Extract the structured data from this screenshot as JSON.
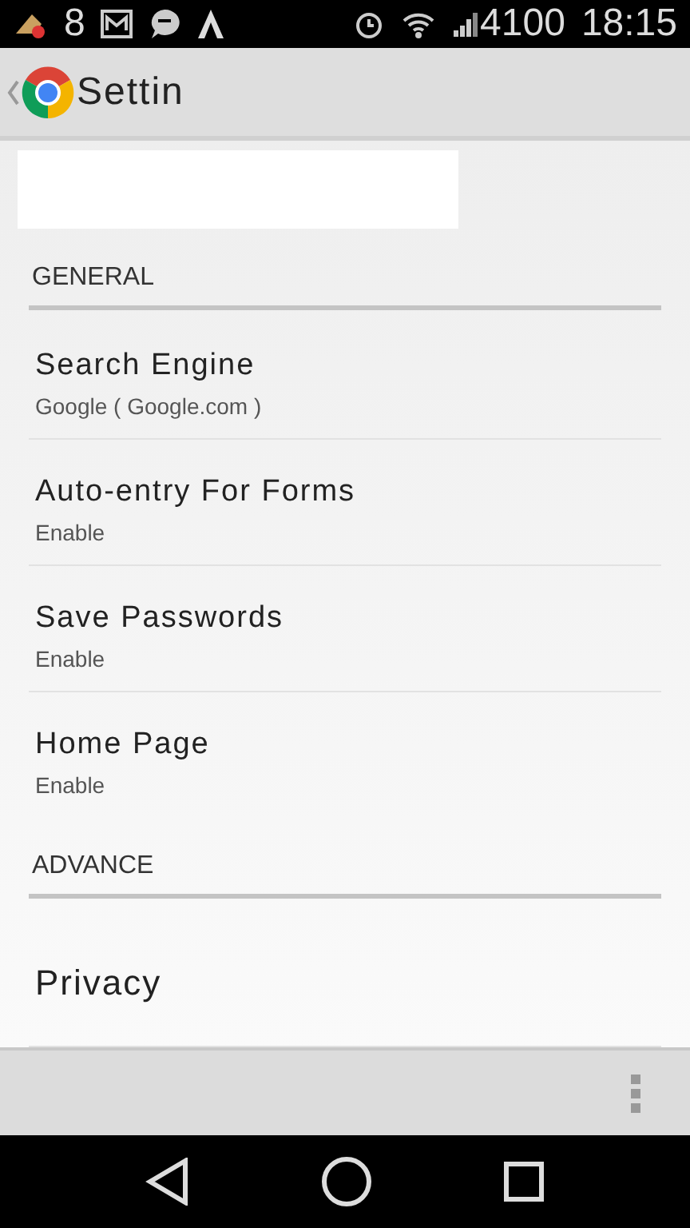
{
  "status_bar": {
    "notification_count": "8",
    "battery": "4100",
    "time": "18:15"
  },
  "app_bar": {
    "title": "Settin"
  },
  "sections": [
    {
      "header": "GENERAL",
      "items": [
        {
          "title": "Search Engine",
          "summary": "Google ( Google.com )"
        },
        {
          "title": "Auto-entry For Forms",
          "summary": "Enable"
        },
        {
          "title": "Save Passwords",
          "summary": "Enable"
        },
        {
          "title": "Home Page",
          "summary": "Enable"
        }
      ]
    },
    {
      "header": "ADVANCE",
      "items": [
        {
          "title": "Privacy"
        }
      ]
    }
  ]
}
